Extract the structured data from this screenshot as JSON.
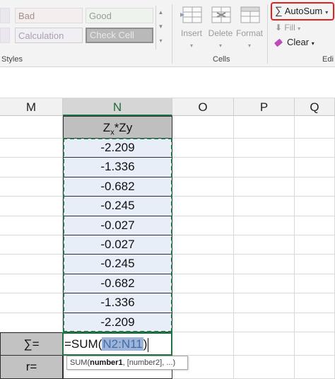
{
  "ribbon": {
    "styles": {
      "bad": "Bad",
      "good": "Good",
      "calculation": "Calculation",
      "check_cell": "Check Cell",
      "group_label": "Styles"
    },
    "cells": {
      "insert": "Insert",
      "delete": "Delete",
      "format": "Format",
      "group_label": "Cells"
    },
    "editing": {
      "autosum": "AutoSum",
      "fill": "Fill",
      "clear": "Clear",
      "group_label": "Edi"
    }
  },
  "grid": {
    "columns": [
      "M",
      "N",
      "O",
      "P",
      "Q"
    ],
    "selected_column": "N",
    "n_header": "Zx*Zy",
    "n_header_main": "Z",
    "n_header_sub": "x",
    "n_header_rest": "*Zy",
    "n_values": [
      "-2.209",
      "-1.336",
      "-0.682",
      "-0.245",
      "-0.027",
      "-0.027",
      "-0.245",
      "-0.682",
      "-1.336",
      "-2.209"
    ],
    "sum_label": "∑=",
    "r_label": "r=",
    "formula_prefix": "=SUM(",
    "formula_ref": "N2:N11",
    "formula_suffix": ")",
    "tooltip_prefix": "SUM(",
    "tooltip_arg1": "number1",
    "tooltip_rest": ", [number2], ...)"
  },
  "colors": {
    "accent_green": "#217346",
    "autosum_highlight": "#e2201f",
    "selection_fill": "#e8eef8",
    "reference_highlight": "#9fb4d6"
  }
}
